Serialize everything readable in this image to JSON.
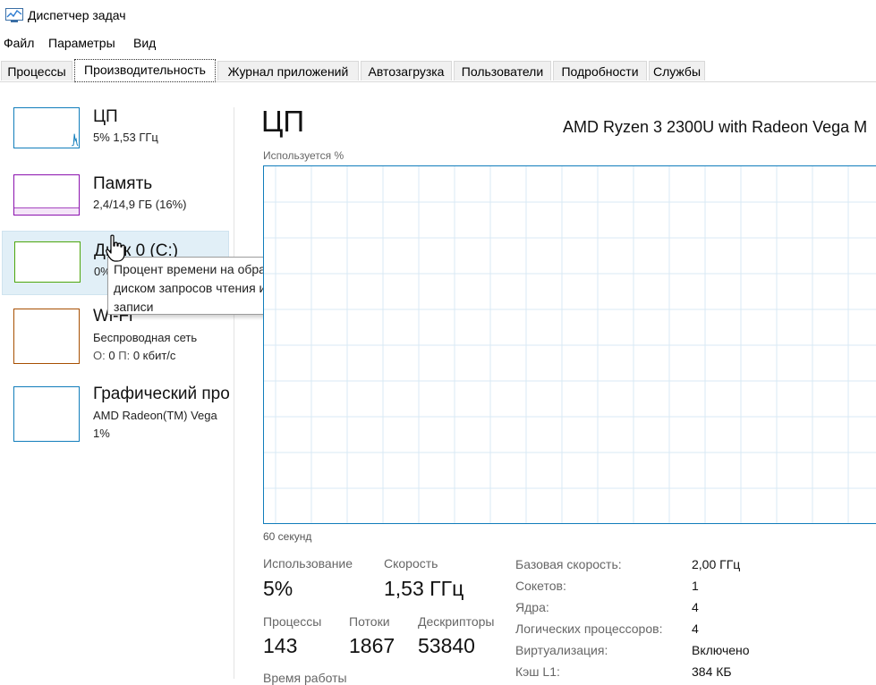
{
  "window": {
    "title": "Диспетчер задач"
  },
  "menu": [
    "Файл",
    "Параметры",
    "Вид"
  ],
  "tabs": [
    "Процессы",
    "Производительность",
    "Журнал приложений",
    "Автозагрузка",
    "Пользователи",
    "Подробности",
    "Службы"
  ],
  "active_tab": "Производительность",
  "resources": [
    {
      "name": "ЦП",
      "line1": "5%  1,53 ГГц",
      "color": "#117dbb"
    },
    {
      "name": "Память",
      "line1": "2,4/14,9 ГБ (16%)",
      "color": "#8b12ae"
    },
    {
      "name": "Диск 0 (C:)",
      "line1": "0%",
      "color": "#4da60c"
    },
    {
      "name": "Wi-Fi",
      "line1": "Беспроводная сеть",
      "line2_prefix1": "О:",
      "line2_value1": "0",
      "line2_prefix2": "П:",
      "line2_value2": "0 кбит/с",
      "color": "#a74f01"
    },
    {
      "name": "Графический про",
      "line1": "AMD Radeon(TM) Vega",
      "line2": "1%",
      "color": "#117dbb"
    }
  ],
  "selected_resource_index": 2,
  "tooltip": {
    "text_lines": [
      "Процент времени на обработку",
      "диском запросов чтения или",
      "записи"
    ]
  },
  "cpu": {
    "title": "ЦП",
    "model": "AMD Ryzen 3 2300U with Radeon Vega M",
    "graph_label": "Используется %",
    "graph_time": "60 секунд",
    "stats": [
      {
        "label": "Использование",
        "value": "5%"
      },
      {
        "label": "Скорость",
        "value": "1,53 ГГц"
      },
      {
        "label": "Процессы",
        "value": "143"
      },
      {
        "label": "Потоки",
        "value": "1867"
      },
      {
        "label": "Дескрипторы",
        "value": "53840"
      }
    ],
    "uptime_label": "Время работы",
    "specs": [
      {
        "label": "Базовая скорость:",
        "value": "2,00 ГГц"
      },
      {
        "label": "Сокетов:",
        "value": "1"
      },
      {
        "label": "Ядра:",
        "value": "4"
      },
      {
        "label": "Логических процессоров:",
        "value": "4"
      },
      {
        "label": "Виртуализация:",
        "value": "Включено"
      },
      {
        "label": "Кэш L1:",
        "value": "384 КБ"
      }
    ]
  },
  "colors": {
    "graph_border": "#117dbb",
    "graph_grid": "#d9eaf4",
    "selected_bg": "#e1eff7"
  }
}
